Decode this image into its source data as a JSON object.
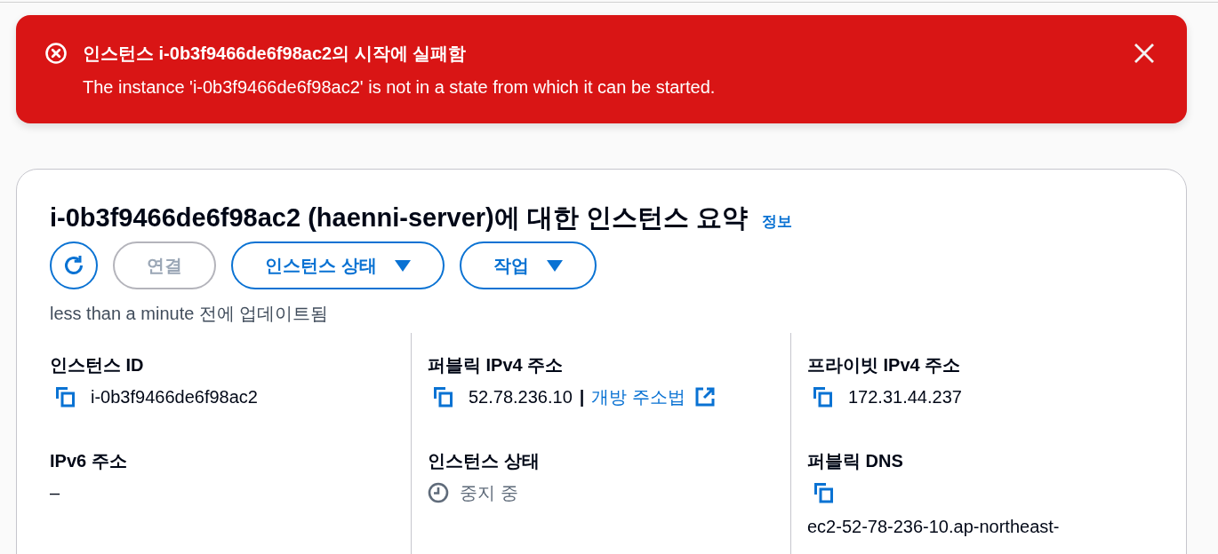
{
  "flash": {
    "kind": "error",
    "title": "인스턴스 i-0b3f9466de6f98ac2의 시작에 실패함",
    "message": "The instance 'i-0b3f9466de6f98ac2' is not in a state from which it can be started.",
    "dismissible": true
  },
  "summary": {
    "title": "i-0b3f9466de6f98ac2 (haenni-server)에 대한 인스턴스 요약",
    "info_link": "정보",
    "actions": [
      {
        "kind": "refresh",
        "disabled": false
      },
      {
        "kind": "button",
        "label": "연결",
        "disabled": true
      },
      {
        "kind": "dropdown",
        "label": "인스턴스 상태",
        "disabled": false
      },
      {
        "kind": "dropdown",
        "label": "작업",
        "disabled": false
      }
    ],
    "updated": "less than a minute 전에 업데이트됨",
    "columns": [
      [
        {
          "label": "인스턴스 ID",
          "kind": "copy",
          "value": "i-0b3f9466de6f98ac2"
        },
        {
          "label": "IPv6 주소",
          "kind": "text",
          "value": "–"
        }
      ],
      [
        {
          "label": "퍼블릭 IPv4 주소",
          "kind": "copy",
          "value": "52.78.236.10",
          "separator": "|",
          "link": "개방 주소법"
        },
        {
          "label": "인스턴스 상태",
          "kind": "status",
          "value": "중지 중"
        }
      ],
      [
        {
          "label": "프라이빗 IPv4 주소",
          "kind": "copy",
          "value": "172.31.44.237"
        },
        {
          "label": "퍼블릭 DNS",
          "kind": "stacked",
          "value": "ec2-52-78-236-10.ap-northeast-"
        }
      ]
    ]
  }
}
